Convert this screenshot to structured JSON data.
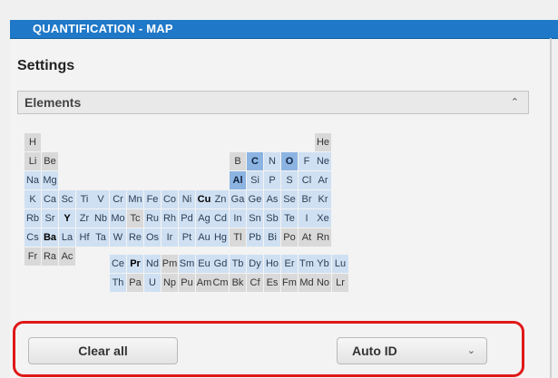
{
  "header": {
    "title": "QUANTIFICATION - MAP"
  },
  "settings": {
    "title": "Settings"
  },
  "elements_section": {
    "label": "Elements",
    "chevron_icon": "chevron-up-icon"
  },
  "periodic_table": {
    "rows": [
      [
        {
          "c": 0,
          "s": "H",
          "t": "avail"
        },
        {
          "c": 17,
          "s": "He",
          "t": "avail"
        }
      ],
      [
        {
          "c": 0,
          "s": "Li",
          "t": "avail"
        },
        {
          "c": 1,
          "s": "Be",
          "t": "avail"
        },
        {
          "c": 12,
          "s": "B",
          "t": "avail"
        },
        {
          "c": 13,
          "s": "C",
          "t": "sel"
        },
        {
          "c": 14,
          "s": "N",
          "t": "lblue"
        },
        {
          "c": 15,
          "s": "O",
          "t": "sel"
        },
        {
          "c": 16,
          "s": "F",
          "t": "lblue"
        },
        {
          "c": 17,
          "s": "Ne",
          "t": "lblue"
        }
      ],
      [
        {
          "c": 0,
          "s": "Na",
          "t": "lblue"
        },
        {
          "c": 1,
          "s": "Mg",
          "t": "lblue"
        },
        {
          "c": 12,
          "s": "Al",
          "t": "sel"
        },
        {
          "c": 13,
          "s": "Si",
          "t": "lblue"
        },
        {
          "c": 14,
          "s": "P",
          "t": "lblue"
        },
        {
          "c": 15,
          "s": "S",
          "t": "lblue"
        },
        {
          "c": 16,
          "s": "Cl",
          "t": "lblue"
        },
        {
          "c": 17,
          "s": "Ar",
          "t": "lblue"
        }
      ],
      [
        {
          "c": 0,
          "s": "K",
          "t": "lblue"
        },
        {
          "c": 1,
          "s": "Ca",
          "t": "lblue"
        },
        {
          "c": 2,
          "s": "Sc",
          "t": "lblue"
        },
        {
          "c": 3,
          "s": "Ti",
          "t": "lblue"
        },
        {
          "c": 4,
          "s": "V",
          "t": "lblue"
        },
        {
          "c": 5,
          "s": "Cr",
          "t": "lblue"
        },
        {
          "c": 6,
          "s": "Mn",
          "t": "lblue"
        },
        {
          "c": 7,
          "s": "Fe",
          "t": "lblue"
        },
        {
          "c": 8,
          "s": "Co",
          "t": "lblue"
        },
        {
          "c": 9,
          "s": "Ni",
          "t": "lblue"
        },
        {
          "c": 10,
          "s": "Cu",
          "t": "lblue",
          "b": true
        },
        {
          "c": 11,
          "s": "Zn",
          "t": "lblue"
        },
        {
          "c": 12,
          "s": "Ga",
          "t": "lblue"
        },
        {
          "c": 13,
          "s": "Ge",
          "t": "lblue"
        },
        {
          "c": 14,
          "s": "As",
          "t": "lblue"
        },
        {
          "c": 15,
          "s": "Se",
          "t": "lblue"
        },
        {
          "c": 16,
          "s": "Br",
          "t": "lblue"
        },
        {
          "c": 17,
          "s": "Kr",
          "t": "lblue"
        }
      ],
      [
        {
          "c": 0,
          "s": "Rb",
          "t": "lblue"
        },
        {
          "c": 1,
          "s": "Sr",
          "t": "lblue"
        },
        {
          "c": 2,
          "s": "Y",
          "t": "lblue",
          "b": true
        },
        {
          "c": 3,
          "s": "Zr",
          "t": "lblue"
        },
        {
          "c": 4,
          "s": "Nb",
          "t": "lblue"
        },
        {
          "c": 5,
          "s": "Mo",
          "t": "lblue"
        },
        {
          "c": 6,
          "s": "Tc",
          "t": "avail"
        },
        {
          "c": 7,
          "s": "Ru",
          "t": "lblue"
        },
        {
          "c": 8,
          "s": "Rh",
          "t": "lblue"
        },
        {
          "c": 9,
          "s": "Pd",
          "t": "lblue"
        },
        {
          "c": 10,
          "s": "Ag",
          "t": "lblue"
        },
        {
          "c": 11,
          "s": "Cd",
          "t": "lblue"
        },
        {
          "c": 12,
          "s": "In",
          "t": "lblue"
        },
        {
          "c": 13,
          "s": "Sn",
          "t": "lblue"
        },
        {
          "c": 14,
          "s": "Sb",
          "t": "lblue"
        },
        {
          "c": 15,
          "s": "Te",
          "t": "lblue"
        },
        {
          "c": 16,
          "s": "I",
          "t": "lblue"
        },
        {
          "c": 17,
          "s": "Xe",
          "t": "lblue"
        }
      ],
      [
        {
          "c": 0,
          "s": "Cs",
          "t": "lblue"
        },
        {
          "c": 1,
          "s": "Ba",
          "t": "lblue",
          "b": true
        },
        {
          "c": 2,
          "s": "La",
          "t": "lblue"
        },
        {
          "c": 3,
          "s": "Hf",
          "t": "lblue"
        },
        {
          "c": 4,
          "s": "Ta",
          "t": "lblue"
        },
        {
          "c": 5,
          "s": "W",
          "t": "lblue"
        },
        {
          "c": 6,
          "s": "Re",
          "t": "lblue"
        },
        {
          "c": 7,
          "s": "Os",
          "t": "lblue"
        },
        {
          "c": 8,
          "s": "Ir",
          "t": "lblue"
        },
        {
          "c": 9,
          "s": "Pt",
          "t": "lblue"
        },
        {
          "c": 10,
          "s": "Au",
          "t": "lblue"
        },
        {
          "c": 11,
          "s": "Hg",
          "t": "lblue"
        },
        {
          "c": 12,
          "s": "Tl",
          "t": "avail"
        },
        {
          "c": 13,
          "s": "Pb",
          "t": "lblue"
        },
        {
          "c": 14,
          "s": "Bi",
          "t": "lblue"
        },
        {
          "c": 15,
          "s": "Po",
          "t": "avail"
        },
        {
          "c": 16,
          "s": "At",
          "t": "avail"
        },
        {
          "c": 17,
          "s": "Rn",
          "t": "avail"
        }
      ],
      [
        {
          "c": 0,
          "s": "Fr",
          "t": "avail"
        },
        {
          "c": 1,
          "s": "Ra",
          "t": "avail"
        },
        {
          "c": 2,
          "s": "Ac",
          "t": "avail"
        }
      ]
    ],
    "lanthanides": [
      {
        "s": "Ce",
        "t": "lblue"
      },
      {
        "s": "Pr",
        "t": "lblue",
        "b": true
      },
      {
        "s": "Nd",
        "t": "lblue"
      },
      {
        "s": "Pm",
        "t": "avail"
      },
      {
        "s": "Sm",
        "t": "lblue"
      },
      {
        "s": "Eu",
        "t": "lblue"
      },
      {
        "s": "Gd",
        "t": "lblue"
      },
      {
        "s": "Tb",
        "t": "lblue"
      },
      {
        "s": "Dy",
        "t": "lblue"
      },
      {
        "s": "Ho",
        "t": "lblue"
      },
      {
        "s": "Er",
        "t": "lblue"
      },
      {
        "s": "Tm",
        "t": "lblue"
      },
      {
        "s": "Yb",
        "t": "lblue"
      },
      {
        "s": "Lu",
        "t": "lblue"
      }
    ],
    "actinides": [
      {
        "s": "Th",
        "t": "lblue"
      },
      {
        "s": "Pa",
        "t": "avail"
      },
      {
        "s": "U",
        "t": "lblue"
      },
      {
        "s": "Np",
        "t": "avail"
      },
      {
        "s": "Pu",
        "t": "avail"
      },
      {
        "s": "Am",
        "t": "avail"
      },
      {
        "s": "Cm",
        "t": "avail"
      },
      {
        "s": "Bk",
        "t": "avail"
      },
      {
        "s": "Cf",
        "t": "avail"
      },
      {
        "s": "Es",
        "t": "avail"
      },
      {
        "s": "Fm",
        "t": "avail"
      },
      {
        "s": "Md",
        "t": "avail"
      },
      {
        "s": "No",
        "t": "avail"
      },
      {
        "s": "Lr",
        "t": "avail"
      }
    ]
  },
  "actions": {
    "clear_all_label": "Clear all",
    "auto_id_label": "Auto ID",
    "auto_id_chevron_icon": "chevron-down-icon",
    "highlight_color": "#e01818"
  },
  "colors": {
    "title_bar": "#1f78c8",
    "selected_element": "#8cb4e2",
    "element_light": "#cfe0f2"
  }
}
